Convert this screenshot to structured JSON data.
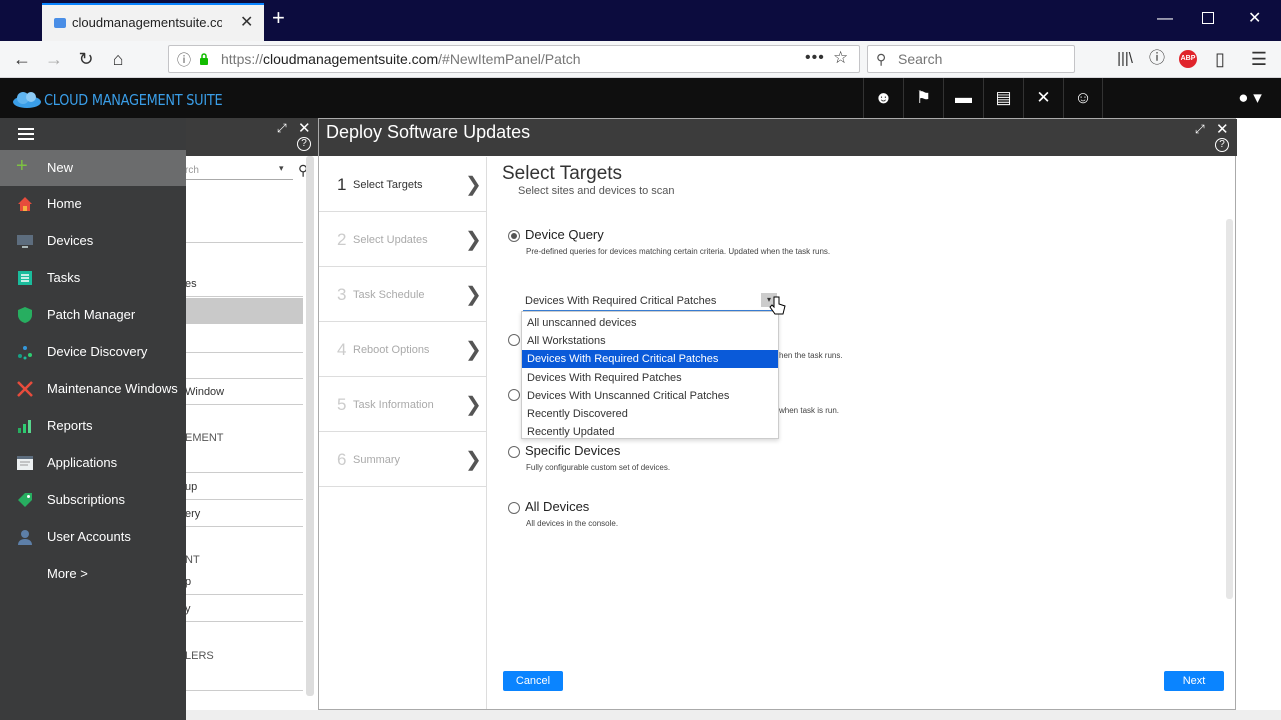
{
  "browser": {
    "tab_title": "cloudmanagementsuite.com",
    "url_prefix": "https://",
    "url_domain": "cloudmanagementsuite.com",
    "url_path": "/#NewItemPanel/Patch",
    "search_placeholder": "Search"
  },
  "app": {
    "name": "CLOUD MANAGEMENT SUITE",
    "accent": "#3a9ee8"
  },
  "sidebar": {
    "items": [
      {
        "label": "New",
        "icon": "plus-icon"
      },
      {
        "label": "Home",
        "icon": "home-icon"
      },
      {
        "label": "Devices",
        "icon": "monitor-icon"
      },
      {
        "label": "Tasks",
        "icon": "tasks-icon"
      },
      {
        "label": "Patch Manager",
        "icon": "shield-icon"
      },
      {
        "label": "Device Discovery",
        "icon": "network-icon"
      },
      {
        "label": "Maintenance Windows",
        "icon": "tools-icon"
      },
      {
        "label": "Reports",
        "icon": "bar-chart-icon"
      },
      {
        "label": "Applications",
        "icon": "window-icon"
      },
      {
        "label": "Subscriptions",
        "icon": "tag-icon"
      },
      {
        "label": "User Accounts",
        "icon": "user-icon"
      },
      {
        "label": "More >",
        "icon": ""
      }
    ]
  },
  "background_panel": {
    "search_fragment": "rch",
    "rows": [
      "es",
      "Window",
      "up",
      "ery",
      "p",
      "y"
    ],
    "sections": [
      "EMENT",
      "NT",
      "LERS"
    ]
  },
  "deploy": {
    "title": "Deploy Software Updates",
    "steps": [
      {
        "num": "1",
        "label": "Select Targets"
      },
      {
        "num": "2",
        "label": "Select Updates"
      },
      {
        "num": "3",
        "label": "Task Schedule"
      },
      {
        "num": "4",
        "label": "Reboot Options"
      },
      {
        "num": "5",
        "label": "Task Information"
      },
      {
        "num": "6",
        "label": "Summary"
      }
    ],
    "heading": "Select Targets",
    "subheading": "Select sites and devices to scan",
    "options": {
      "device_query": {
        "label": "Device Query",
        "desc": "Pre-defined queries for devices matching certain criteria. Updated when the task runs."
      },
      "hidden2_desc_tail": "hen the task runs.",
      "hidden3_desc_tail": "when task is run.",
      "specific": {
        "label": "Specific Devices",
        "desc": "Fully configurable custom set of devices."
      },
      "all": {
        "label": "All Devices",
        "desc": "All devices in the console."
      }
    },
    "select_value": "Devices With Required Critical Patches",
    "dropdown_options": [
      "All unscanned devices",
      "All Workstations",
      "Devices With Required Critical Patches",
      "Devices With Required Patches",
      "Devices With Unscanned Critical Patches",
      "Recently Discovered",
      "Recently Updated"
    ],
    "cancel_label": "Cancel",
    "next_label": "Next"
  }
}
